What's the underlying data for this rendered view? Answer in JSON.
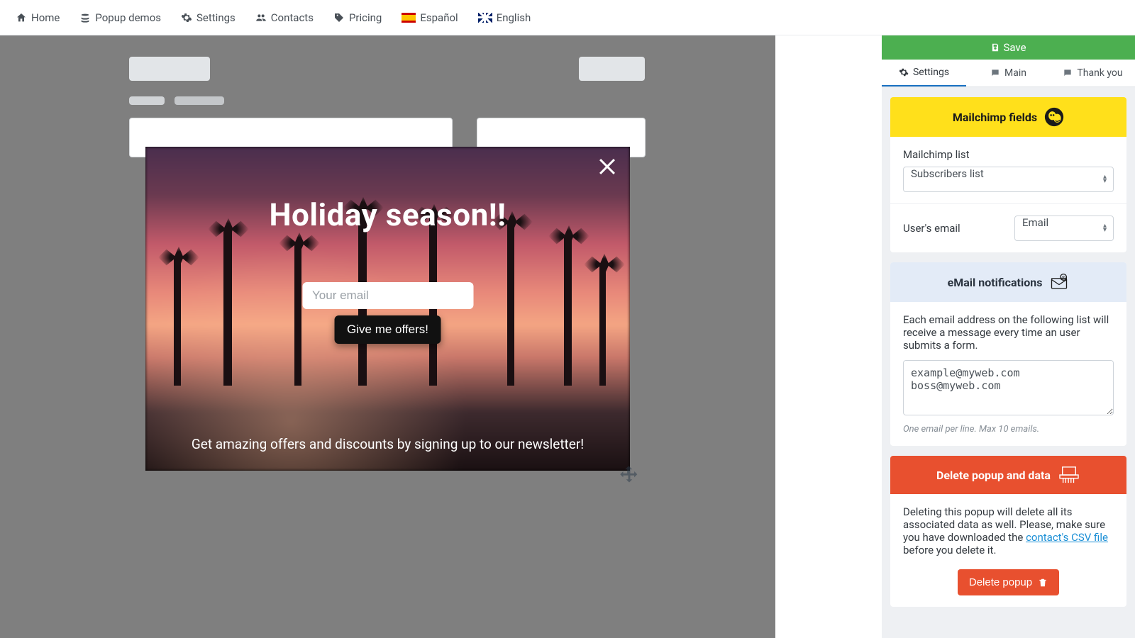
{
  "nav": {
    "home": "Home",
    "popup_demos": "Popup demos",
    "settings": "Settings",
    "contacts": "Contacts",
    "pricing": "Pricing",
    "spanish": "Español",
    "english": "English"
  },
  "save_bar": "Save",
  "tabs": {
    "settings": "Settings",
    "main": "Main",
    "thank_you": "Thank you"
  },
  "popup": {
    "title": "Holiday season!!",
    "email_placeholder": "Your email",
    "cta": "Give me offers!",
    "subtitle": "Get amazing offers and discounts by signing up to our newsletter!"
  },
  "mailchimp": {
    "header": "Mailchimp fields",
    "list_label": "Mailchimp list",
    "list_value": "Subscribers list",
    "email_label": "User's email",
    "email_value": "Email"
  },
  "email_notif": {
    "header": "eMail notifications",
    "desc": "Each email address on the following list will receive a message every time an user submits a form.",
    "textarea": "example@myweb.com\nboss@myweb.com",
    "hint": "One email per line. Max 10 emails."
  },
  "danger": {
    "header": "Delete popup and data",
    "desc_before": "Deleting this popup will delete all its associated data as well. Please, make sure you have downloaded the ",
    "link": "contact's CSV file",
    "desc_after": " before you delete it.",
    "button": "Delete popup"
  }
}
